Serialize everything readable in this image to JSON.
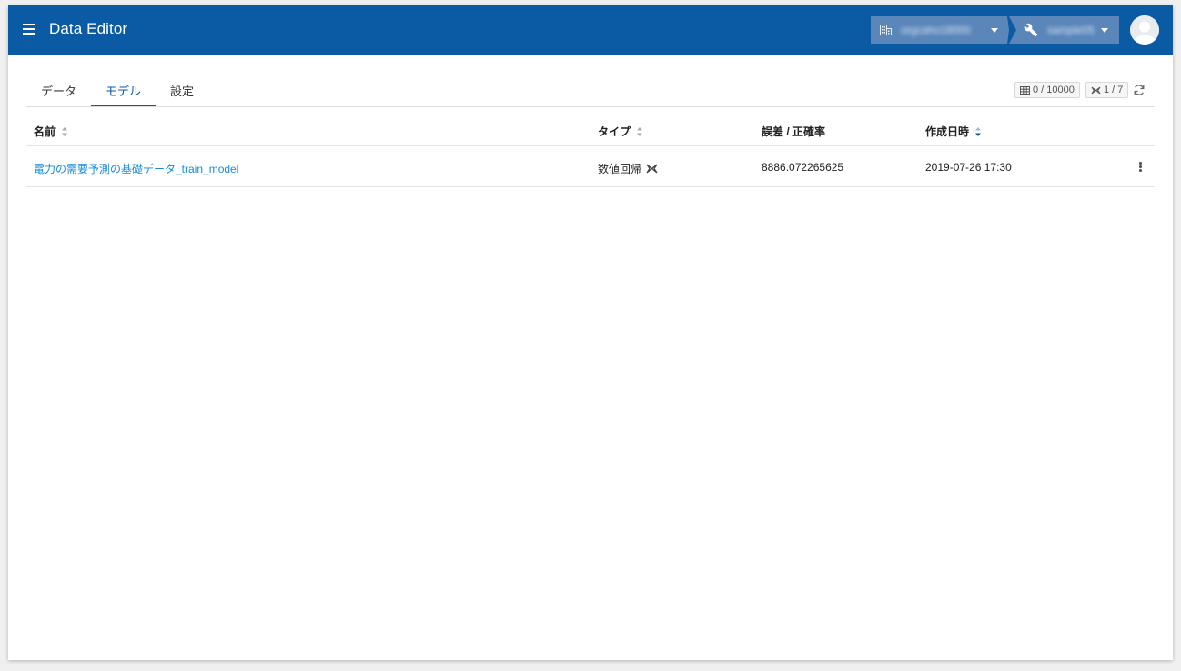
{
  "header": {
    "app_title": "Data Editor",
    "organization": {
      "icon": "building-icon",
      "label": "orgcaho18000"
    },
    "project": {
      "icon": "wrench-icon",
      "label": "sample05"
    },
    "accent_color": "#0b5aa4"
  },
  "tabs": [
    {
      "label": "データ",
      "active": false
    },
    {
      "label": "モデル",
      "active": true
    },
    {
      "label": "設定",
      "active": false
    }
  ],
  "stats": {
    "rows": {
      "icon": "table-icon",
      "text": "0 / 10000"
    },
    "models": {
      "icon": "model-icon",
      "text": "1 / 7"
    }
  },
  "table": {
    "columns": [
      {
        "label": "名前",
        "sortable": true,
        "sort": "none"
      },
      {
        "label": "タイプ",
        "sortable": true,
        "sort": "none"
      },
      {
        "label": "誤差 / 正確率",
        "sortable": false
      },
      {
        "label": "作成日時",
        "sortable": true,
        "sort": "desc"
      }
    ],
    "rows": [
      {
        "name": "電力の需要予測の基礎データ_train_model",
        "type": "数値回帰",
        "type_icon": "regression-icon",
        "score": "8886.072265625",
        "created": "2019-07-26 17:30"
      }
    ]
  }
}
